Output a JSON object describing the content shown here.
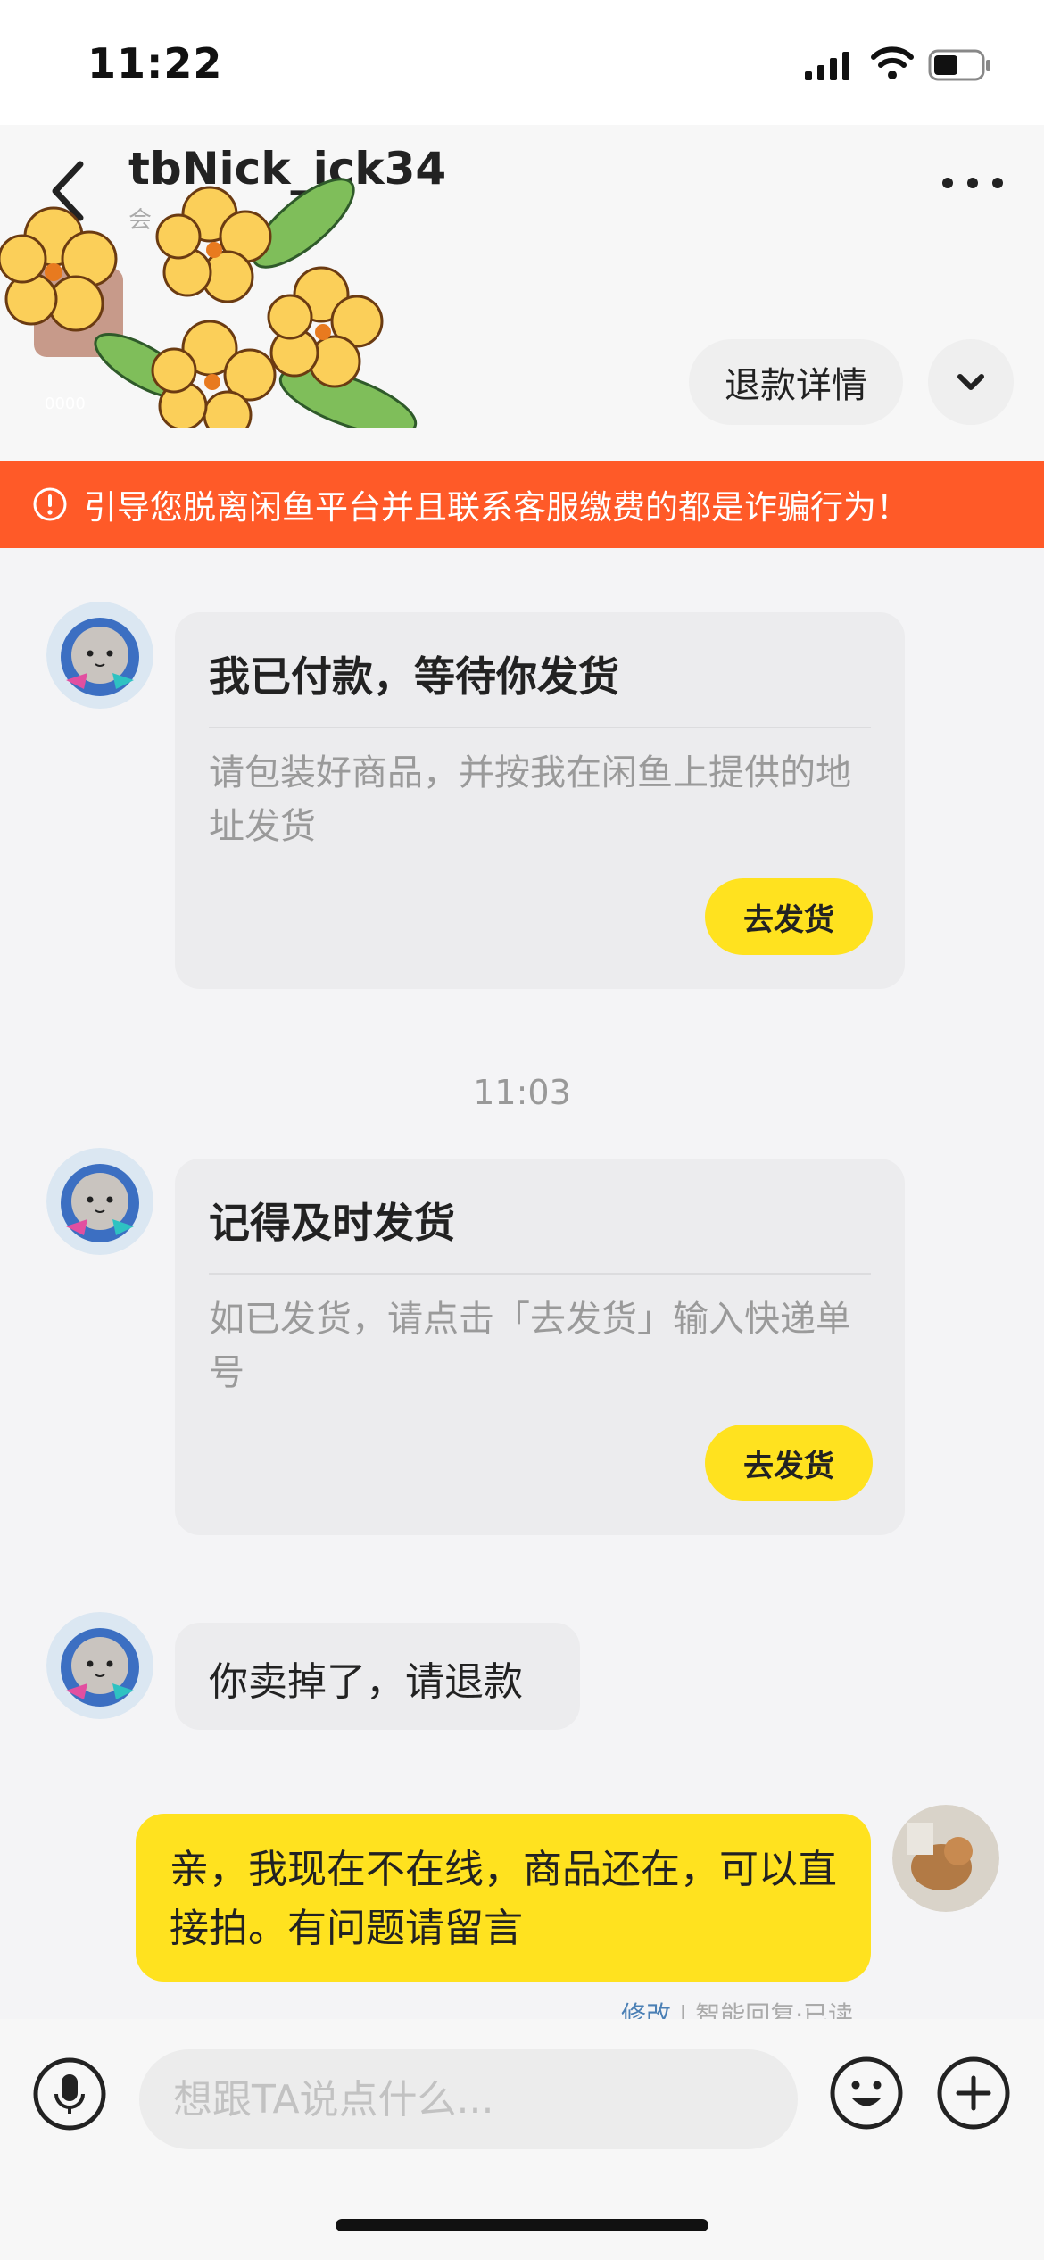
{
  "status_bar": {
    "time": "11:22"
  },
  "header": {
    "title": "tbNick_ick34",
    "subtitle": "会",
    "product_price_small": "0000",
    "product_price_tag": "00",
    "refund_label": "退款详情"
  },
  "warning": {
    "text": "引导您脱离闲鱼平台并且联系客服缴费的都是诈骗行为！"
  },
  "messages": {
    "card1": {
      "title": "我已付款，等待你发货",
      "body": "请包装好商品，并按我在闲鱼上提供的地址发货",
      "button": "去发货"
    },
    "time": "11:03",
    "card2": {
      "title": "记得及时发货",
      "body": "如已发货，请点击「去发货」输入快递单号",
      "button": "去发货"
    },
    "buyer_text": "你卖掉了，请退款",
    "seller_text": "亲，我现在不在线，商品还在，可以直接拍。有问题请留言",
    "meta_edit": "修改",
    "meta_status": "智能回复·已读"
  },
  "input": {
    "placeholder": "想跟TA说点什么..."
  },
  "colors": {
    "accent_yellow": "#ffe21f",
    "warning_orange": "#ff5a28"
  },
  "icons": [
    "back-icon",
    "more-icon",
    "chevron-down-icon",
    "warning-icon",
    "mic-icon",
    "emoji-icon",
    "plus-icon"
  ]
}
